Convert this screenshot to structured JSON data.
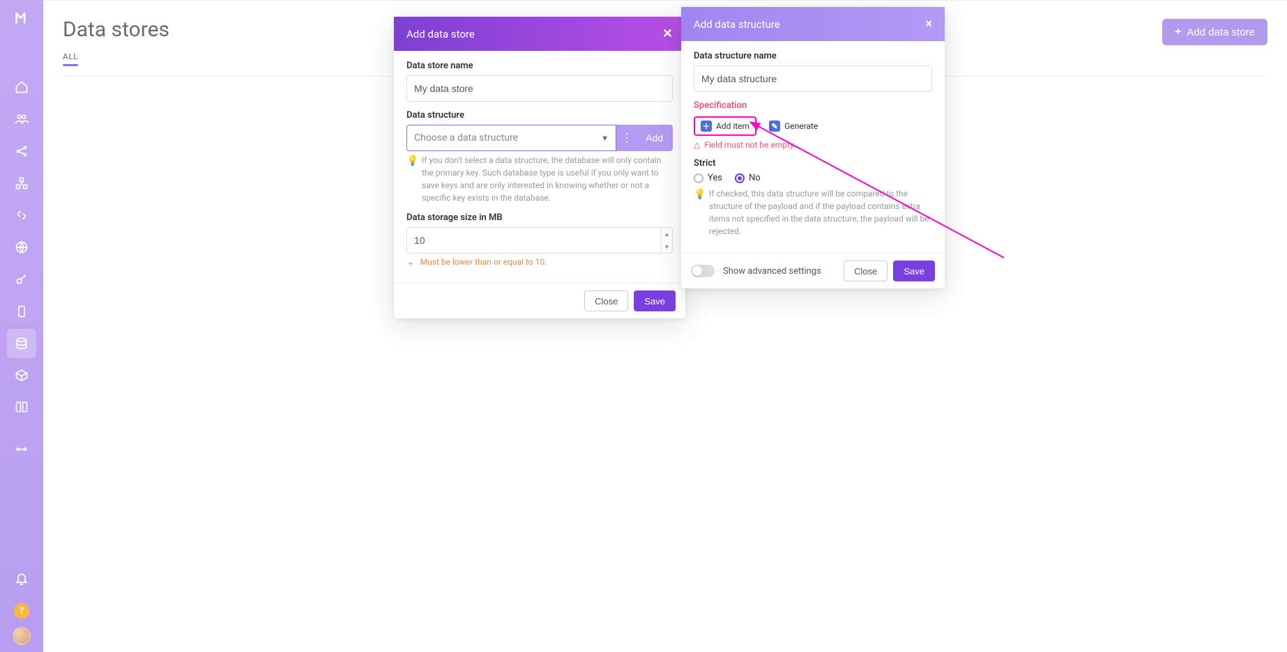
{
  "page": {
    "title": "Data stores",
    "tab_all": "ALL",
    "add_button": "Add data store"
  },
  "sidebar": {
    "items": [
      {
        "name": "home-icon"
      },
      {
        "name": "team-icon"
      },
      {
        "name": "share-icon"
      },
      {
        "name": "puzzle-icon"
      },
      {
        "name": "link-icon"
      },
      {
        "name": "globe-icon"
      },
      {
        "name": "key-icon"
      },
      {
        "name": "device-icon"
      },
      {
        "name": "datastore-icon",
        "active": true
      },
      {
        "name": "cube-icon"
      },
      {
        "name": "book-icon"
      },
      {
        "name": "git-icon"
      }
    ]
  },
  "modal_ds": {
    "title": "Add data store",
    "name_label": "Data store name",
    "name_value": "My data store",
    "structure_label": "Data structure",
    "structure_placeholder": "Choose a data structure",
    "add_label": "Add",
    "structure_hint": "If you don't select a data structure, the database will only contain the primary key. Such database type is useful if you only want to save keys and are only interested in knowing whether or not a specific key exists in the database.",
    "size_label": "Data storage size in MB",
    "size_value": "10",
    "size_warn": "Must be lower than or equal to 10.",
    "close": "Close",
    "save": "Save"
  },
  "modal_str": {
    "title": "Add data structure",
    "name_label": "Data structure name",
    "name_value": "My data structure",
    "spec_label": "Specification",
    "add_item": "Add item",
    "generate": "Generate",
    "err": "Field must not be empty.",
    "strict_label": "Strict",
    "yes": "Yes",
    "no": "No",
    "strict_hint": "If checked, this data structure will be compared to the structure of the payload and if the payload contains extra items not specified in the data structure, the payload will be rejected.",
    "advanced": "Show advanced settings",
    "close": "Close",
    "save": "Save"
  }
}
